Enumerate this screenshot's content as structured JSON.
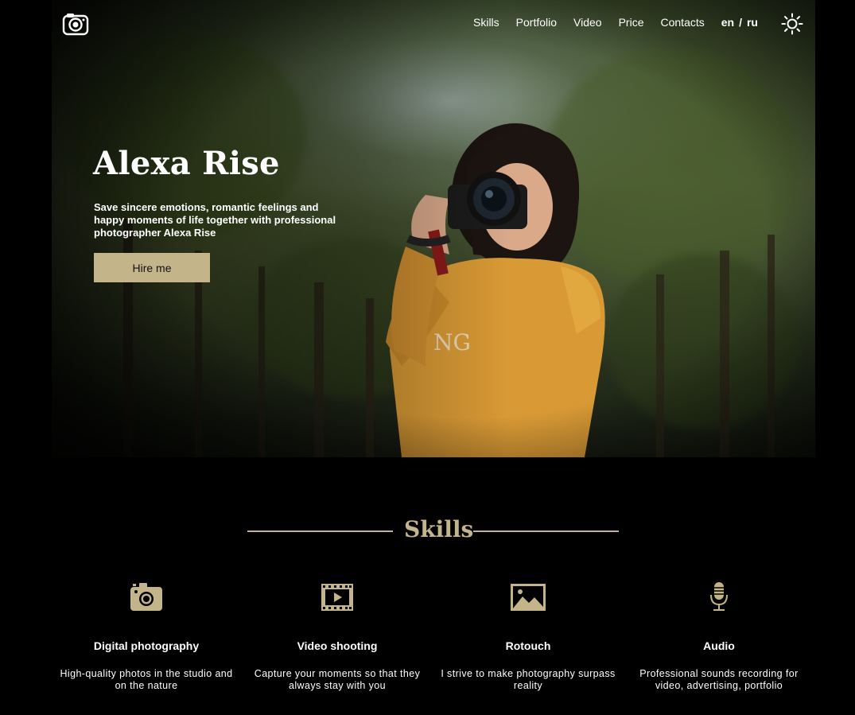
{
  "header": {
    "logo_icon": "camera-logo-icon",
    "nav": [
      "Skills",
      "Portfolio",
      "Video",
      "Price",
      "Contacts"
    ],
    "lang": [
      "en",
      "/",
      "ru"
    ],
    "theme_icon": "sun-icon"
  },
  "hero": {
    "title": "Alexa Rise",
    "text": "Save sincere emotions, romantic feelings and happy moments of life together with professional photographer Alexa Rise",
    "button": "Hire me"
  },
  "skills": {
    "title": "Skills",
    "items": [
      {
        "icon": "camera-icon",
        "title": "Digital photography",
        "desc": "High-quality photos in the studio and on the nature"
      },
      {
        "icon": "video-icon",
        "title": "Video shooting",
        "desc": "Capture your moments so that they always stay with you"
      },
      {
        "icon": "image-icon",
        "title": "Rotouch",
        "desc": "I strive to make photography surpass reality"
      },
      {
        "icon": "microphone-icon",
        "title": "Audio",
        "desc": "Professional sounds recording for video, advertising, portfolio"
      }
    ]
  },
  "colors": {
    "accent": "#c4b48a",
    "background": "#000000"
  }
}
